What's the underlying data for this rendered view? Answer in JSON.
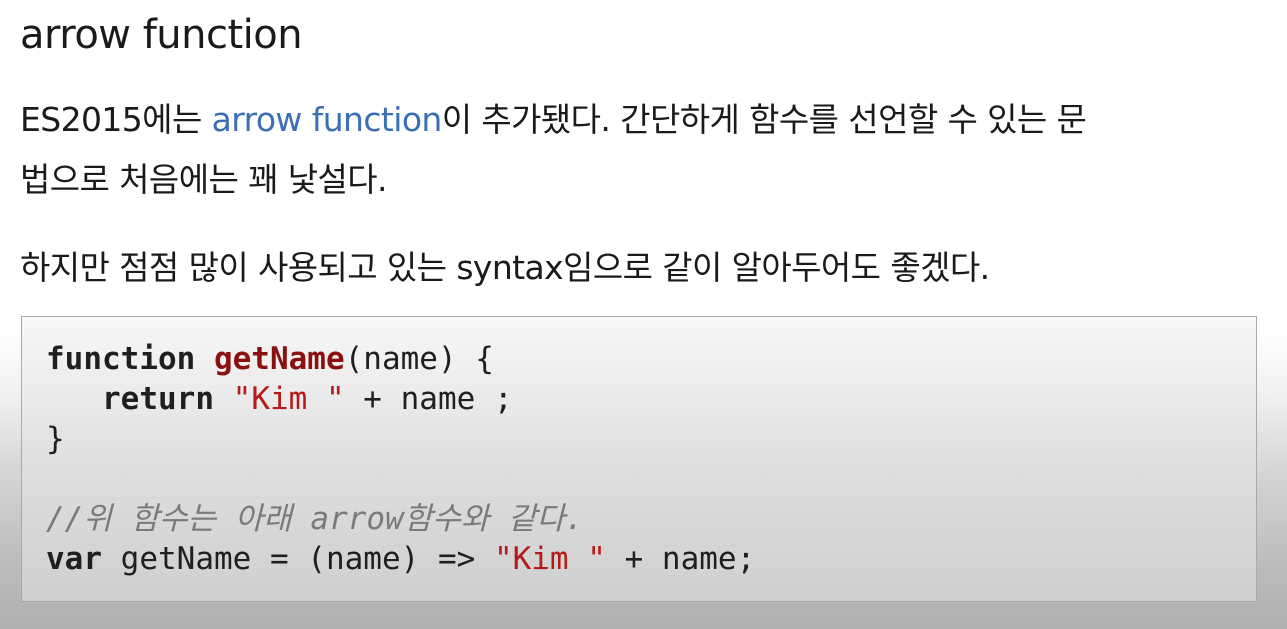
{
  "heading": "arrow function",
  "paragraph1": {
    "before_link": "ES2015에는 ",
    "link_text": "arrow function",
    "after_link_line1": "이 추가됐다. 간단하게 함수를 선언할 수 있는 문",
    "line2": "법으로 처음에는 꽤 낯설다."
  },
  "paragraph2": "하지만 점점 많이 사용되고 있는 syntax임으로 같이 알아두어도 좋겠다.",
  "code": {
    "line1": {
      "kw": "function",
      "space1": " ",
      "fn": "getName",
      "rest": "(name) {"
    },
    "line2": {
      "indent": "   ",
      "kw": "return",
      "space": " ",
      "str": "\"Kim \"",
      "rest": " + name ;"
    },
    "line3": "}",
    "line4": "",
    "comment": "//위 함수는 아래 arrow함수와 같다.",
    "line6": {
      "kw": "var",
      "mid": " getName = (name) => ",
      "str": "\"Kim \"",
      "rest": " + name;"
    }
  },
  "colors": {
    "link": "#3b6fb6",
    "function_name": "#8b1111",
    "string": "#b51a1a",
    "comment": "#7a7a7a"
  }
}
